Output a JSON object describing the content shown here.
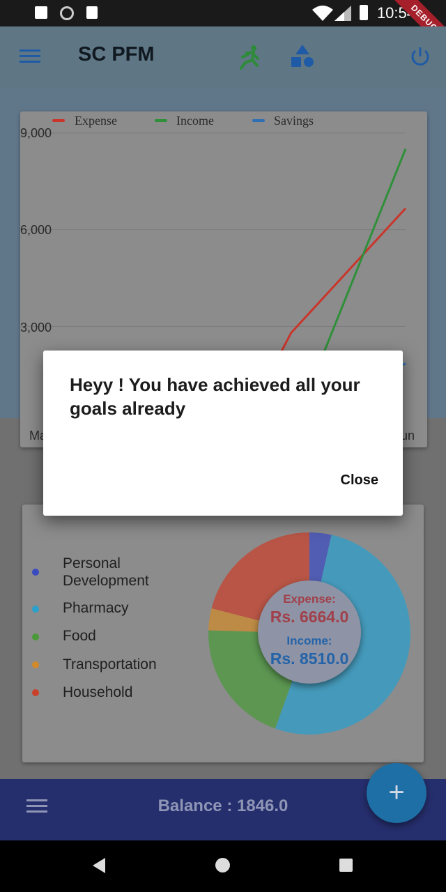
{
  "status_bar": {
    "time": "10:54",
    "debug_banner": "DEBUG"
  },
  "app_bar": {
    "title": "SC PFM",
    "icons": [
      "menu-icon",
      "running-person-icon",
      "shapes-icon",
      "power-icon"
    ],
    "colors": {
      "background": "#5f7785",
      "run_icon": "#2e8b3a",
      "shapes_icon": "#1f5aa6"
    }
  },
  "chart_data": {
    "type": "line",
    "legend": [
      {
        "name": "Expense",
        "color": "#c9352b"
      },
      {
        "name": "Income",
        "color": "#2f8f3a"
      },
      {
        "name": "Savings",
        "color": "#2f6fb3"
      }
    ],
    "y_ticks": [
      "9,000",
      "6,000",
      "3,000"
    ],
    "x_tick_left": "Ma",
    "x_tick_right": "Jun",
    "ylim": [
      0,
      9000
    ],
    "series": [
      {
        "name": "Expense",
        "points": [
          [
            0.62,
            2000
          ],
          [
            0.66,
            2800
          ],
          [
            1.0,
            6664
          ]
        ]
      },
      {
        "name": "Income",
        "points": [
          [
            0.75,
            2000
          ],
          [
            1.0,
            8510
          ]
        ]
      },
      {
        "name": "Savings",
        "points": [
          [
            1.0,
            1846
          ]
        ]
      }
    ]
  },
  "pie": {
    "categories": [
      {
        "label": "Personal\nDevelopment",
        "color": "#3a4bc0"
      },
      {
        "label": "Pharmacy",
        "color": "#2aa0cd"
      },
      {
        "label": "Food",
        "color": "#4a9a3a"
      },
      {
        "label": "Transportation",
        "color": "#d08a2a"
      },
      {
        "label": "Household",
        "color": "#c9402b"
      }
    ],
    "slices_percent": [
      3.5,
      52.0,
      20.0,
      3.5,
      21.0
    ],
    "expense_label": "Expense:",
    "expense_value": "Rs. 6664.0",
    "income_label": "Income:",
    "income_value": "Rs. 8510.0"
  },
  "dialog": {
    "message": "Heyy ! You have achieved all your goals already",
    "close_label": "Close"
  },
  "bottom_bar": {
    "balance": "Balance : 1846.0",
    "fab_label": "+"
  }
}
